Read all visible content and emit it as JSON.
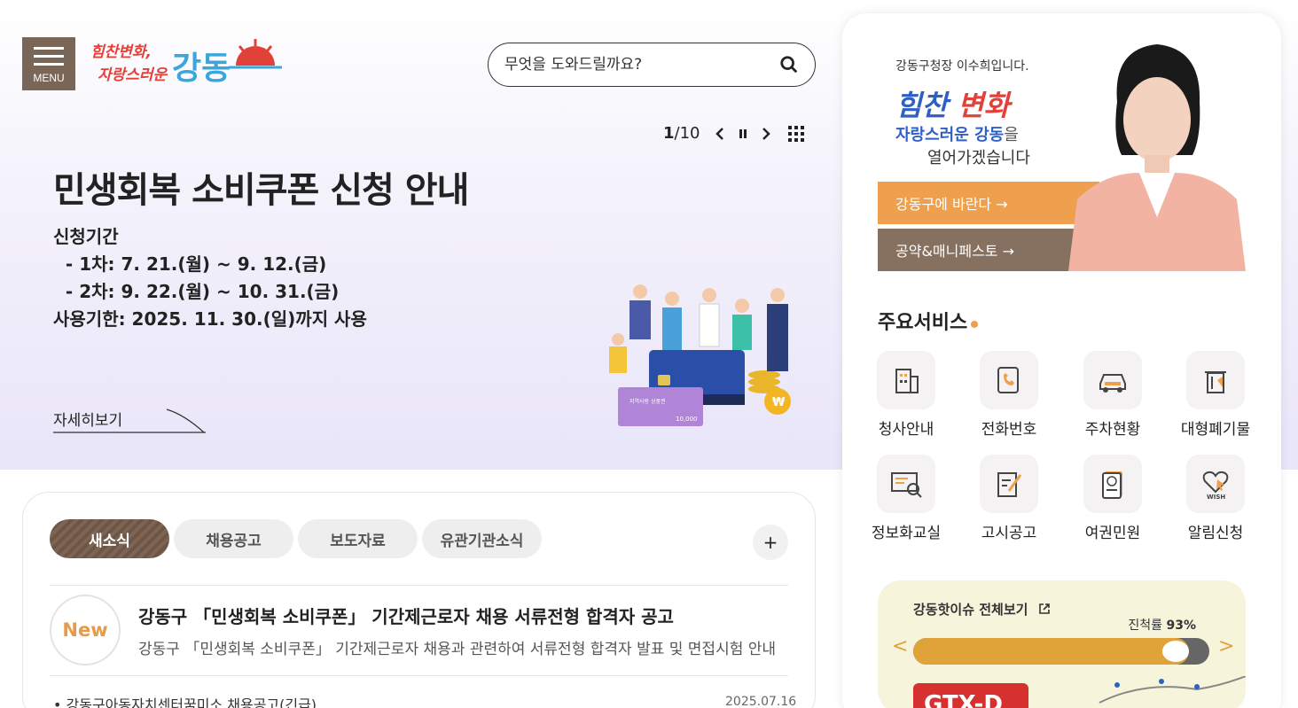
{
  "header": {
    "menu_label": "MENU",
    "logo_line1": "힘찬변화,",
    "logo_line2": "자랑스러운",
    "logo_main": "강동",
    "search_placeholder": "무엇을 도와드릴까요?"
  },
  "slider": {
    "current": "1",
    "separator": "/",
    "total": "10"
  },
  "hero": {
    "title": "민생회복 소비쿠폰 신청 안내",
    "lines": [
      "신청기간",
      "  - 1차: 7. 21.(월) ~ 9. 12.(금)",
      "  - 2차: 9. 22.(월) ~ 10. 31.(금)",
      "사용기한: 2025. 11. 30.(일)까지 사용"
    ],
    "more_label": "자세히보기",
    "card_text": "지역사랑\n상품권",
    "card_amount": "10,000",
    "coin_symbol": "₩"
  },
  "mayor": {
    "greeting": "강동구청장 이수희입니다.",
    "slogan_blue": "힘찬",
    "slogan_red": "변화",
    "line2_blue": "자랑스러운 강동",
    "line2_gray": "을",
    "line3": "열어가겠습니다",
    "btn1": "강동구에 바란다 →",
    "btn2": "공약&매니페스토 →"
  },
  "services": {
    "title": "주요서비스",
    "items": [
      {
        "label": "청사안내",
        "icon": "building-icon"
      },
      {
        "label": "전화번호",
        "icon": "phone-icon"
      },
      {
        "label": "주차현황",
        "icon": "car-icon"
      },
      {
        "label": "대형폐기물",
        "icon": "trash-icon"
      },
      {
        "label": "정보화교실",
        "icon": "computer-icon"
      },
      {
        "label": "고시공고",
        "icon": "notice-icon"
      },
      {
        "label": "여권민원",
        "icon": "passport-icon"
      },
      {
        "label": "알림신청",
        "icon": "wish-icon"
      }
    ]
  },
  "issue": {
    "title": "강동핫이슈 전체보기",
    "progress_label": "진척률",
    "progress_value": "93%",
    "progress_fraction": 0.93,
    "map_label": "GTX-D"
  },
  "news": {
    "tabs": [
      "새소식",
      "채용공고",
      "보도자료",
      "유관기관소식"
    ],
    "plus": "+",
    "badge": "New",
    "headline": "강동구 「민생회복 소비쿠폰」 기간제근로자 채용 서류전형 합격자 공고",
    "description": "강동구 「민생회복 소비쿠폰」 기간제근로자 채용과 관련하여 서류전형 합격자 발표 및 면접시험 안내",
    "item1": "• 강동구아동자치센터꿈미소 채용공고(긴급)",
    "item1_date": "2025.07.16"
  },
  "colors": {
    "brown": "#7a6656",
    "orange": "#eea04e",
    "blue": "#2f5fc4",
    "red": "#e2413a"
  }
}
